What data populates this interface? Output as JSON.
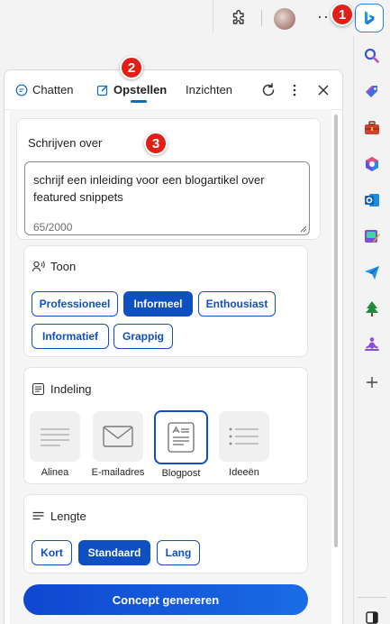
{
  "browser": {
    "more_label": "···"
  },
  "badges": [
    "1",
    "2",
    "3"
  ],
  "tabs": [
    {
      "label": "Chatten"
    },
    {
      "label": "Opstellen"
    },
    {
      "label": "Inzichten"
    }
  ],
  "write_about": {
    "title": "Schrijven over",
    "text": "schrijf een inleiding voor een blogartikel over featured snippets",
    "counter": "65/2000"
  },
  "tone": {
    "title": "Toon",
    "options": [
      "Professioneel",
      "Informeel",
      "Enthousiast",
      "Informatief",
      "Grappig"
    ],
    "selected": "Informeel"
  },
  "format": {
    "title": "Indeling",
    "options": [
      "Alinea",
      "E-mailadres",
      "Blogpost",
      "Ideeën"
    ],
    "selected": "Blogpost"
  },
  "length": {
    "title": "Lengte",
    "options": [
      "Kort",
      "Standaard",
      "Lang"
    ],
    "selected": "Standaard"
  },
  "generate_label": "Concept genereren",
  "colors": {
    "accent": "#0f4fc1",
    "badge": "#e11f17",
    "tab_underline": "#0f6cbd"
  },
  "rail_icons": [
    "search-icon",
    "tag-icon",
    "toolbox-icon",
    "microsoft365-icon",
    "outlook-icon",
    "designer-icon",
    "send-icon",
    "tree-icon",
    "meditation-icon",
    "add-icon",
    "sidebar-toggle-icon"
  ]
}
